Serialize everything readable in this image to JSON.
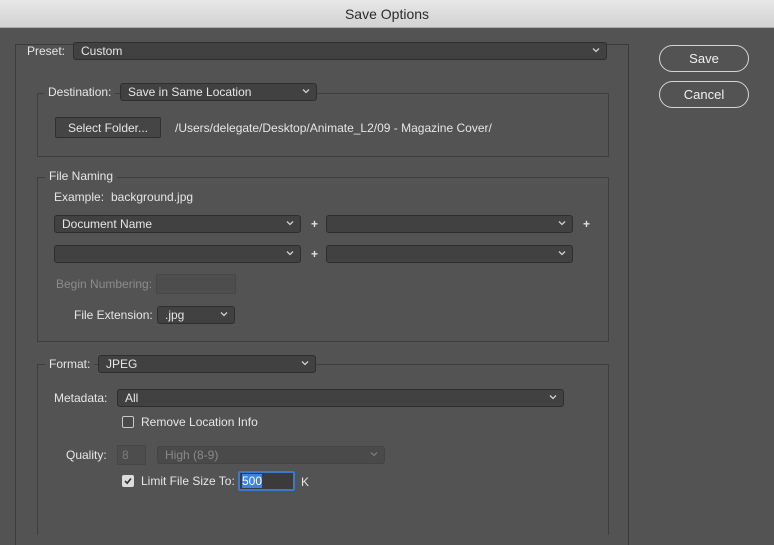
{
  "window": {
    "title": "Save Options"
  },
  "preset": {
    "label": "Preset:",
    "value": "Custom"
  },
  "actions": {
    "save_label": "Save",
    "cancel_label": "Cancel"
  },
  "destination": {
    "label": "Destination:",
    "value": "Save in Same Location",
    "select_folder_label": "Select Folder...",
    "path": "/Users/delegate/Desktop/Animate_L2/09 - Magazine Cover/"
  },
  "file_naming": {
    "title": "File Naming",
    "example_label": "Example:",
    "example_value": "background.jpg",
    "fields": [
      "Document Name",
      "",
      "",
      ""
    ],
    "plus": "+",
    "begin_numbering_label": "Begin Numbering:",
    "begin_numbering_value": "",
    "file_extension_label": "File Extension:",
    "file_extension_value": ".jpg"
  },
  "format": {
    "label": "Format:",
    "value": "JPEG",
    "metadata_label": "Metadata:",
    "metadata_value": "All",
    "remove_location_label": "Remove Location Info",
    "remove_location_checked": false,
    "quality_label": "Quality:",
    "quality_value": "8",
    "quality_preset": "High  (8-9)",
    "limit_size_label": "Limit File Size To:",
    "limit_size_checked": true,
    "limit_size_value": "500",
    "limit_size_unit": "K"
  }
}
